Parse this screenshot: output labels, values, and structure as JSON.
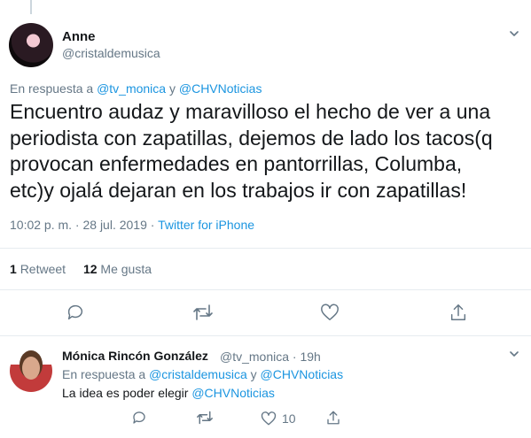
{
  "main_tweet": {
    "author_name": "Anne",
    "author_handle": "@cristaldemusica",
    "reply_prefix": "En respuesta a ",
    "reply_handle_1": "@tv_monica",
    "reply_and": " y ",
    "reply_handle_2": "@CHVNoticias",
    "text": "Encuentro audaz y maravilloso el hecho de ver a una periodista con zapatillas, dejemos de lado los tacos(q provocan enfermedades en pantorrillas, Columba, etc)y ojalá dejaran en los trabajos ir con zapatillas!",
    "timestamp": "10:02 p. m. · 28 jul. 2019",
    "meta_sep": " · ",
    "source": "Twitter for iPhone",
    "retweet_count": "1",
    "retweet_label": "Retweet",
    "like_count": "12",
    "like_label": "Me gusta"
  },
  "reply_tweet": {
    "author_name": "Mónica Rincón González",
    "author_handle": "@tv_monica · 19h",
    "reply_prefix": "En respuesta a ",
    "reply_handle_1": "@cristaldemusica",
    "reply_and": " y ",
    "reply_handle_2": "@CHVNoticias",
    "text_prefix": "La idea es poder elegir ",
    "text_mention": "@CHVNoticias",
    "like_count": "10"
  },
  "colors": {
    "link": "#1b95e0",
    "secondary_text": "#657786",
    "divider": "#e6ecf0",
    "icon": "#657786"
  },
  "icons": [
    "chevron-down-icon",
    "reply-icon",
    "retweet-icon",
    "heart-icon",
    "share-icon"
  ]
}
